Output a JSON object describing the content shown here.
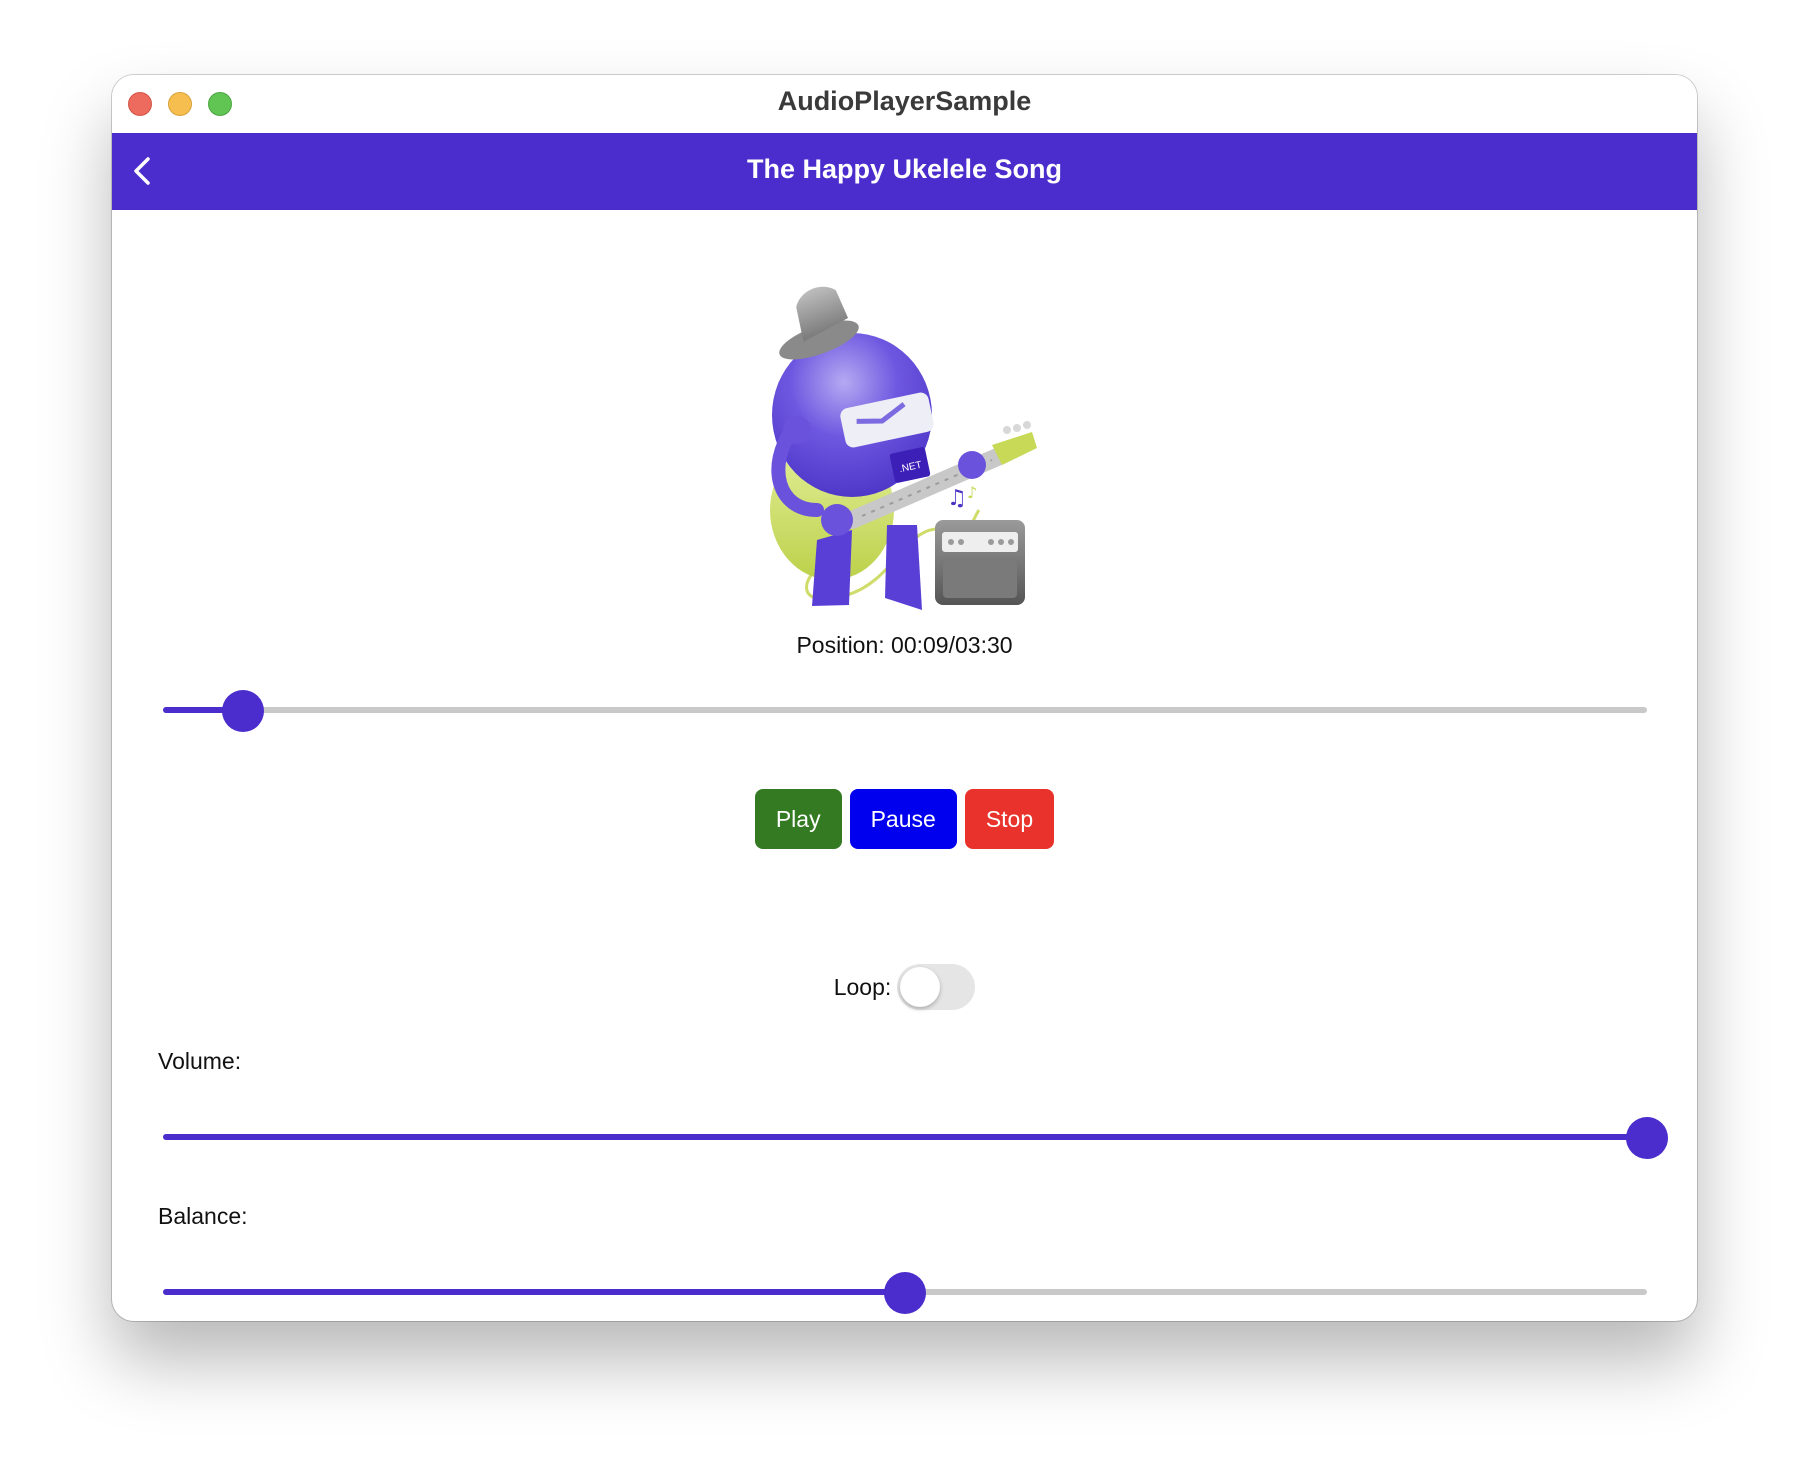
{
  "window": {
    "title": "AudioPlayerSample"
  },
  "navbar": {
    "title": "The Happy Ukelele Song",
    "back_icon": "chevron-left-icon"
  },
  "artwork": {
    "badge_text": ".NET"
  },
  "player": {
    "position_text": "Position: 00:09/03:30",
    "position_fraction": 0.054,
    "buttons": {
      "play": "Play",
      "pause": "Pause",
      "stop": "Stop"
    },
    "loop_label": "Loop:",
    "loop_on": false,
    "volume_label": "Volume:",
    "volume_fraction": 1.0,
    "balance_label": "Balance:",
    "balance_fraction": 0.5
  },
  "colors": {
    "accent": "#4b2ccc",
    "play": "#337a22",
    "pause": "#0000ee",
    "stop": "#e8322b",
    "track": "#c9c9c9"
  }
}
